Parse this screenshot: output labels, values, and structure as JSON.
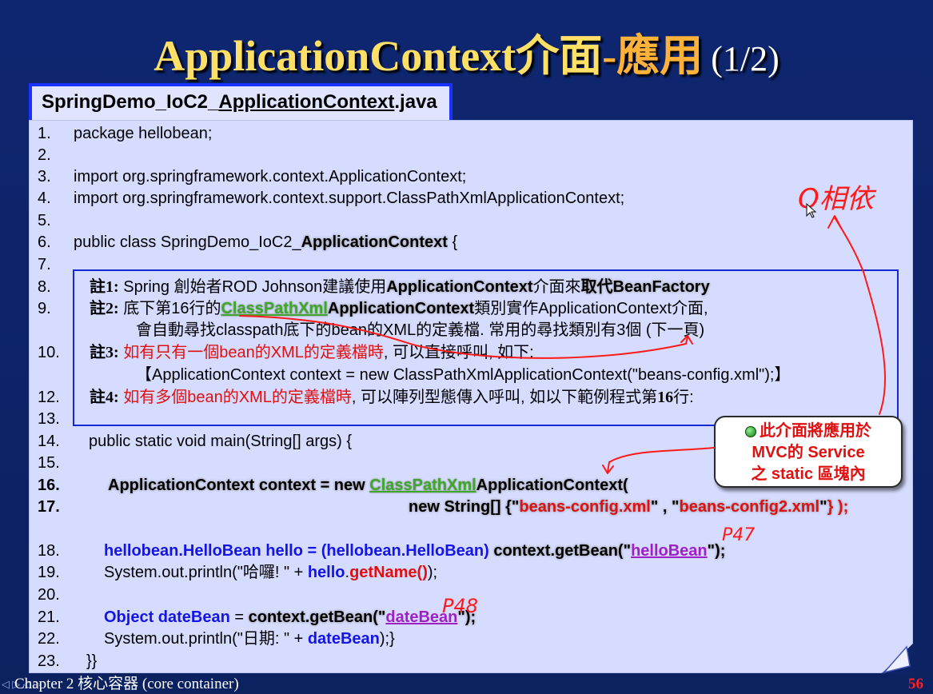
{
  "slide": {
    "title": {
      "word1": "ApplicationContext介面",
      "dash": "-",
      "word2": "應用",
      "page": "(1/2)"
    },
    "tab": {
      "prefix": "SpringDemo_IoC2_",
      "emph": "ApplicationContext",
      "suffix": ".java"
    },
    "code": {
      "n1": "1.",
      "l1": "package hellobean;",
      "n2": "2.",
      "n3": "3.",
      "l3": "import org.springframework.context.ApplicationContext;",
      "n4": "4.",
      "l4": "import org.springframework.context.support.ClassPathXmlApplicationContext;",
      "n5": "5.",
      "n6": "6.",
      "l6a": "public class SpringDemo_IoC2_",
      "l6b": "ApplicationContext",
      "l6c": " {",
      "n7": "7.",
      "n8": "8.",
      "l8a": "註1:",
      "l8b": " Spring 創始者ROD Johnson建議使用",
      "l8c": "ApplicationContext",
      "l8d": "介面來",
      "l8e": "取代BeanFactory",
      "n9": "9.",
      "l9a": "註2:",
      "l9b": " 底下第16行的",
      "l9c": "ClassPathXml",
      "l9d": "ApplicationContext",
      "l9e": "類別實作ApplicationContext介面,",
      "l9f": "會自動尋找classpath底下的bean的XML的定義檔. 常用的尋找類別有3個 (下一頁)",
      "n10": "10.",
      "l10a": "註3:",
      "l10b": " 如有只有一個bean的XML的定義檔時",
      "l10c": ", 可以直接呼叫, 如下:",
      "l11": "【ApplicationContext context = new ClassPathXmlApplicationContext(\"beans-config.xml\");】",
      "n12": "12.",
      "l12a": "註4:",
      "l12b": " 如有多個bean的XML的定義檔時",
      "l12c": ", 可以陣列型態傳入呼叫, 如以下範例程式第",
      "l12d": "16",
      "l12e": "行:",
      "n13": "13.",
      "n14": "14.",
      "l14": "public static void main(String[] args) {",
      "n15": "15.",
      "n16": "16.",
      "l16a": "ApplicationContext context = new ",
      "l16b": "ClassPathXml",
      "l16c": "ApplicationContext(",
      "n17": "17.",
      "l17a": "new String[] {\"",
      "l17b": "beans-config.xml",
      "l17c": "\" , \"",
      "l17d": "beans-config2.xml",
      "l17e": "\"",
      "l17f": "} );",
      "n18": "18.",
      "l18a": "hellobean.HelloBean hello = (hellobean.HelloBean) ",
      "l18b": "context.getBean(\"",
      "l18c": "helloBean",
      "l18d": "\");",
      "n19": "19.",
      "l19a": "System.out.println(\"哈囉! \" + ",
      "l19b": "hello",
      "l19c": ".",
      "l19d": "getName()",
      "l19e": ");",
      "n20": "20.",
      "n21": "21.",
      "l21a": "Object dateBean",
      "l21b": " = ",
      "l21c": "context.getBean(\"",
      "l21d": "dateBean",
      "l21e": "\");",
      "n22": "22.",
      "l22a": "System.out.println(\"日期: \" + ",
      "l22b": "dateBean",
      "l22c": ");}",
      "n23": "23.",
      "l23": "}}"
    },
    "callout": {
      "line1": "此介面將應用於",
      "line2": "MVC的 Service",
      "line3": "之 static 區塊內"
    },
    "annotations": {
      "top_right": "O相依",
      "p47": "P47",
      "p48": "P48"
    },
    "footer": {
      "nav": "◁ ▷ ◁ ▷",
      "chapter": "Chapter 2 核心容器 (core container)",
      "page_number": "56"
    }
  }
}
